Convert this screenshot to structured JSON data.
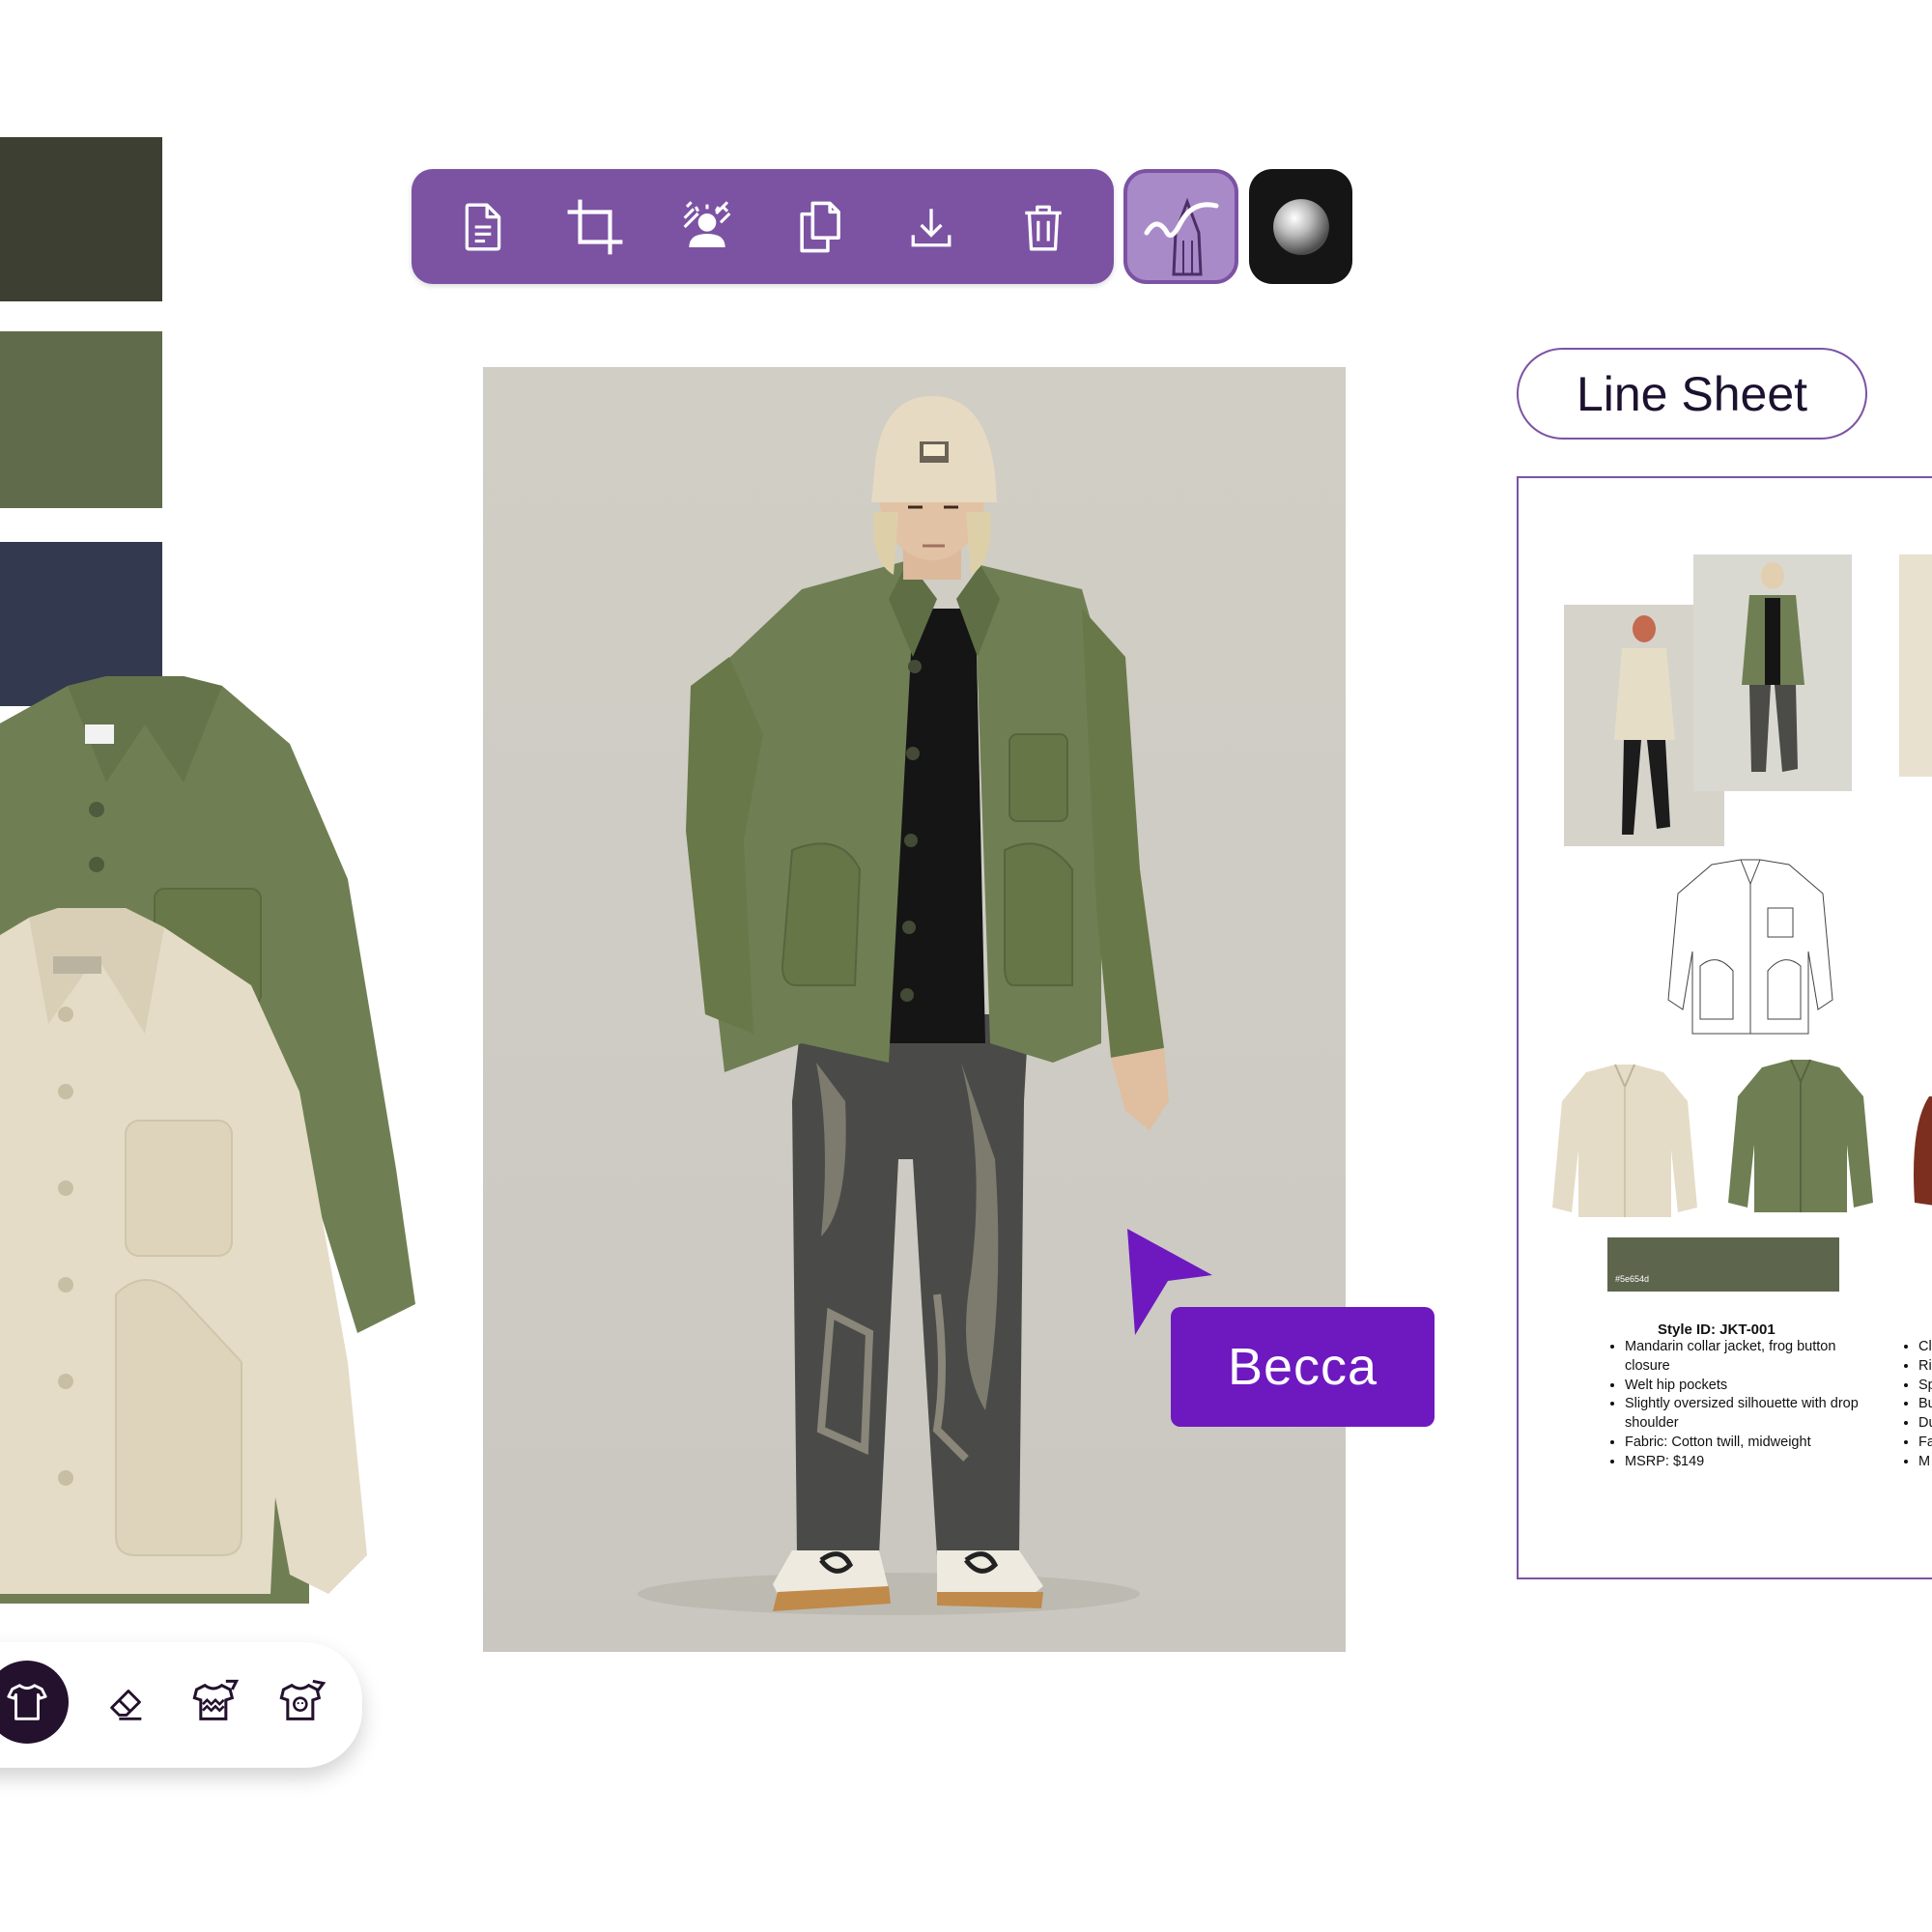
{
  "palette": {
    "swatches": [
      {
        "name": "dark-olive",
        "color": "#3c3f31"
      },
      {
        "name": "sage-green",
        "color": "#5f6b4a"
      },
      {
        "name": "navy",
        "color": "#333a4f"
      }
    ]
  },
  "toolbar": {
    "buttons": [
      {
        "icon": "document-icon"
      },
      {
        "icon": "crop-icon"
      },
      {
        "icon": "background-remove-icon"
      },
      {
        "icon": "duplicate-icon"
      },
      {
        "icon": "download-icon"
      },
      {
        "icon": "trash-icon"
      }
    ],
    "color": "#7c52a3",
    "pen_icon": "pencil-sketch-icon",
    "material_icon": "sphere-icon"
  },
  "cursor": {
    "user_label": "Becca",
    "color": "#6e18c0"
  },
  "line_sheet": {
    "heading": "Line Sheet",
    "swatch_hex": "#5e654d",
    "swatch_color": "#5e654d",
    "style_id": "Style ID: JKT-001",
    "bullets": [
      "Mandarin collar jacket, frog button closure",
      "Welt hip pockets",
      "Slightly oversized silhouette with drop shoulder",
      "Fabric: Cotton twill, midweight",
      "MSRP: $149"
    ],
    "bullets_cut": [
      "Cl co",
      "Ri",
      "Sp",
      "Bu ha",
      "Du",
      "Fa",
      "M"
    ]
  },
  "dock": {
    "tools": [
      {
        "icon": "tshirt-icon",
        "active": true
      },
      {
        "icon": "eraser-icon",
        "active": false
      },
      {
        "icon": "pattern-brush-icon",
        "active": false
      },
      {
        "icon": "graphic-tee-icon",
        "active": false
      }
    ]
  }
}
